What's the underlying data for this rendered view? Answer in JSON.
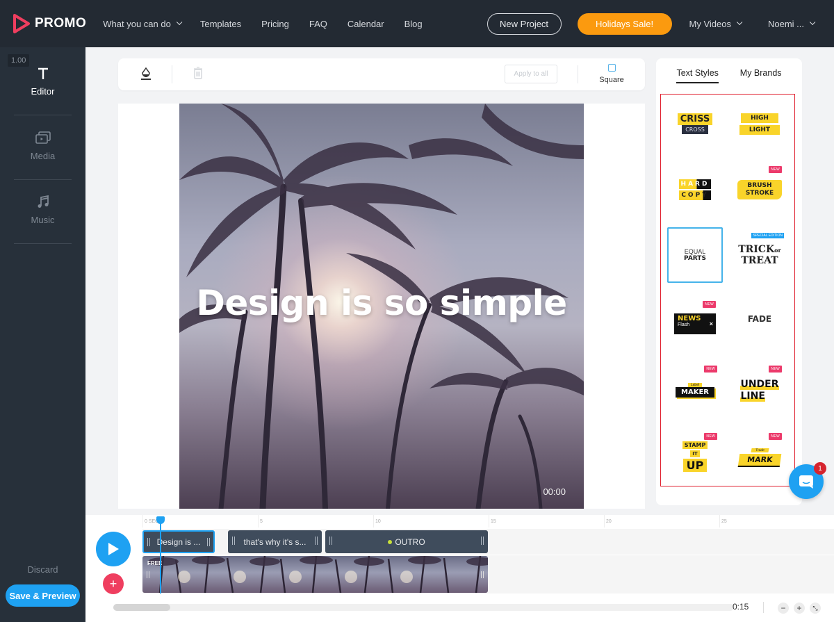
{
  "brand": {
    "name": "PROMO",
    "logo_color": "#ef3e5f"
  },
  "nav": {
    "links": [
      {
        "label": "What you can do",
        "has_dropdown": true
      },
      {
        "label": "Templates"
      },
      {
        "label": "Pricing"
      },
      {
        "label": "FAQ"
      },
      {
        "label": "Calendar"
      },
      {
        "label": "Blog"
      }
    ],
    "new_project": "New Project",
    "sale": "Holidays Sale!",
    "my_videos": "My Videos",
    "user": "Noemi ..."
  },
  "sidebar": {
    "zoom_value": "1.00",
    "items": [
      {
        "label": "Editor",
        "icon": "text-icon",
        "active": true
      },
      {
        "label": "Media",
        "icon": "media-icon"
      },
      {
        "label": "Music",
        "icon": "music-note-icon"
      }
    ],
    "discard": "Discard",
    "save_preview": "Save & Preview"
  },
  "toolbar": {
    "apply_all": "Apply to all",
    "square": "Square"
  },
  "canvas": {
    "title_text": "Design is so simple",
    "timecode": "00:00"
  },
  "right_panel": {
    "tabs": [
      "Text Styles",
      "My Brands"
    ],
    "active_tab": "Text Styles",
    "styles": [
      {
        "name": "Criss Cross",
        "lines": [
          "CRISS",
          "CROSS"
        ]
      },
      {
        "name": "Highlight",
        "lines": [
          "HIGH",
          "LIGHT"
        ]
      },
      {
        "name": "Hard Copy",
        "lines": [
          "HARD",
          "COPY"
        ]
      },
      {
        "name": "Brush Stroke",
        "lines": [
          "BRUSH",
          "STROKE"
        ],
        "badge": "NEW"
      },
      {
        "name": "Equal Parts",
        "lines": [
          "EQUAL",
          "PARTS"
        ],
        "selected": true
      },
      {
        "name": "Trick or Treat",
        "lines": [
          "TRICK",
          "or",
          "TREAT"
        ],
        "badge": "SPECIAL EDITION"
      },
      {
        "name": "News Flash",
        "lines": [
          "NEWS",
          "Flash"
        ],
        "badge": "NEW"
      },
      {
        "name": "Fade",
        "lines": [
          "FADE"
        ]
      },
      {
        "name": "Label Maker",
        "lines": [
          "Label",
          "MAKER"
        ],
        "badge": "NEW"
      },
      {
        "name": "Underline",
        "lines": [
          "UNDER",
          "LINE"
        ],
        "badge": "NEW"
      },
      {
        "name": "Stamp It Up",
        "lines": [
          "STAMP",
          "IT",
          "UP"
        ],
        "badge": "NEW"
      },
      {
        "name": "Trade Mark",
        "lines": [
          "Trade",
          "MARK"
        ],
        "badge": "NEW"
      }
    ]
  },
  "chat": {
    "unread": "1"
  },
  "timeline": {
    "ruler_ticks": [
      "0 SEC",
      "5",
      "10",
      "15",
      "20",
      "25"
    ],
    "clips": [
      {
        "label": "Design is ...",
        "selected": true
      },
      {
        "label": "that's why it's s..."
      },
      {
        "label": "OUTRO",
        "dot": true
      }
    ],
    "video_tag": "FREE",
    "duration": "0:15",
    "zoom_out": "−",
    "zoom_in": "+"
  }
}
